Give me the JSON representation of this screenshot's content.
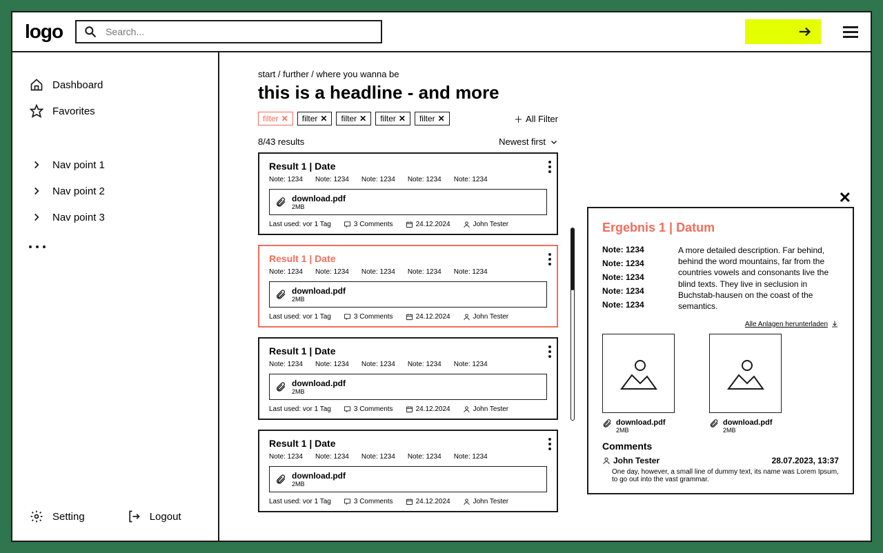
{
  "header": {
    "logo": "logo",
    "search_placeholder": "Search..."
  },
  "sidebar": {
    "items": [
      {
        "label": "Dashboard"
      },
      {
        "label": "Favorites"
      }
    ],
    "nav_points": [
      {
        "label": "Nav point 1"
      },
      {
        "label": "Nav point 2"
      },
      {
        "label": "Nav point 3"
      }
    ],
    "setting_label": "Setting",
    "logout_label": "Logout"
  },
  "main": {
    "breadcrumb": "start / further / where you wanna be",
    "headline": "this is a headline - and more",
    "filters": [
      {
        "label": "filter",
        "active": true
      },
      {
        "label": "filter",
        "active": false
      },
      {
        "label": "filter",
        "active": false
      },
      {
        "label": "filter",
        "active": false
      },
      {
        "label": "filter",
        "active": false
      }
    ],
    "all_filter_label": "All Filter",
    "results_count": "8/43 results",
    "sort_label": "Newest first",
    "result": {
      "title": "Result 1 | Date",
      "note_label": "Note: 1234",
      "download_name": "download.pdf",
      "download_size": "2MB",
      "last_used": "Last used: vor 1 Tag",
      "comments": "3 Comments",
      "date": "24.12.2024",
      "author": "John Tester"
    }
  },
  "detail": {
    "title": "Ergebnis 1 | Datum",
    "note_label": "Note: 1234",
    "description": "A more detailed description. Far behind, behind the word mountains, far from the countries vowels and consonants live the blind texts. They live in seclusion in Buchstab-hausen on the coast of the semantics.",
    "download_all": "Alle Anlagen herunterladen",
    "attachment_name": "download.pdf",
    "attachment_size": "2MB",
    "comments_header": "Comments",
    "comment_author": "John Tester",
    "comment_date": "28.07.2023, 13:37",
    "comment_text": "One day, however, a small line of dummy text, its name was Lorem Ipsum, to go out into the vast grammar."
  }
}
